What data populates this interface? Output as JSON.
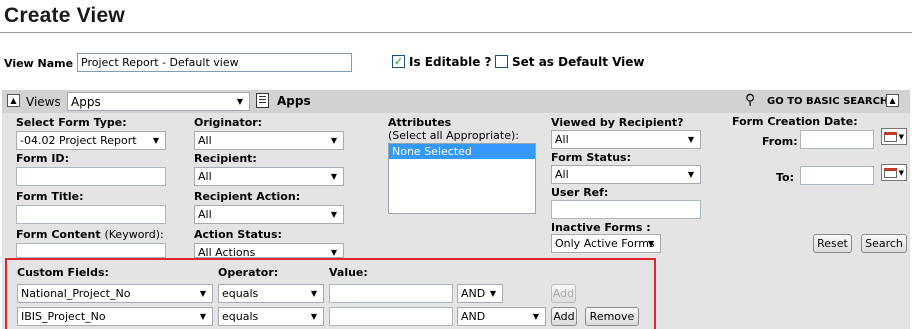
{
  "page": {
    "title": "Create View"
  },
  "view_name": {
    "label": "View Name :",
    "value": "Project Report - Default view"
  },
  "is_editable": {
    "label": "Is Editable ?",
    "checked": true
  },
  "default_view": {
    "label": "Set as Default View",
    "checked": false
  },
  "toolbar": {
    "views_label": "Views",
    "views_select": "Apps",
    "apps_label": "Apps",
    "basic_search": "GO TO BASIC SEARCH"
  },
  "filters": {
    "form_type": {
      "label": "Select Form Type:",
      "value": "-04.02 Project Report"
    },
    "form_id": {
      "label": "Form ID:",
      "value": ""
    },
    "form_title": {
      "label": "Form Title:",
      "value": ""
    },
    "form_content": {
      "label": "Form Content",
      "hint": "(Keyword):",
      "value": ""
    },
    "originator": {
      "label": "Originator:",
      "value": "All"
    },
    "recipient": {
      "label": "Recipient:",
      "value": "All"
    },
    "recipient_action": {
      "label": "Recipient Action:",
      "value": "All"
    },
    "action_status": {
      "label": "Action Status:",
      "value": "All Actions"
    },
    "attributes": {
      "label": "Attributes",
      "hint": "(Select all Appropriate):",
      "options": [
        "None Selected"
      ]
    },
    "viewed_by_recipient": {
      "label": "Viewed by Recipient?",
      "value": "All"
    },
    "form_status": {
      "label": "Form Status:",
      "value": "All"
    },
    "user_ref": {
      "label": "User Ref:",
      "value": ""
    },
    "inactive_forms": {
      "label": "Inactive Forms :",
      "value": "Only Active Forms"
    },
    "creation_date": {
      "label": "Form Creation Date:",
      "from_label": "From:",
      "to_label": "To:",
      "from_value": "",
      "to_value": ""
    },
    "reset_label": "Reset",
    "search_label": "Search"
  },
  "custom_fields": {
    "headers": {
      "field": "Custom Fields:",
      "operator": "Operator:",
      "value": "Value:"
    },
    "rows": [
      {
        "field": "National_Project_No",
        "operator": "equals",
        "value": "",
        "join": "AND",
        "add_label": "Add",
        "add_enabled": false
      },
      {
        "field": "IBIS_Project_No",
        "operator": "equals",
        "value": "",
        "join": "AND",
        "add_label": "Add",
        "add_enabled": true,
        "remove_label": "Remove"
      }
    ]
  },
  "colors": {
    "highlight_border": "#e0272e",
    "selected_option": "#3399ff",
    "panel_bg": "#e4e4e4"
  }
}
